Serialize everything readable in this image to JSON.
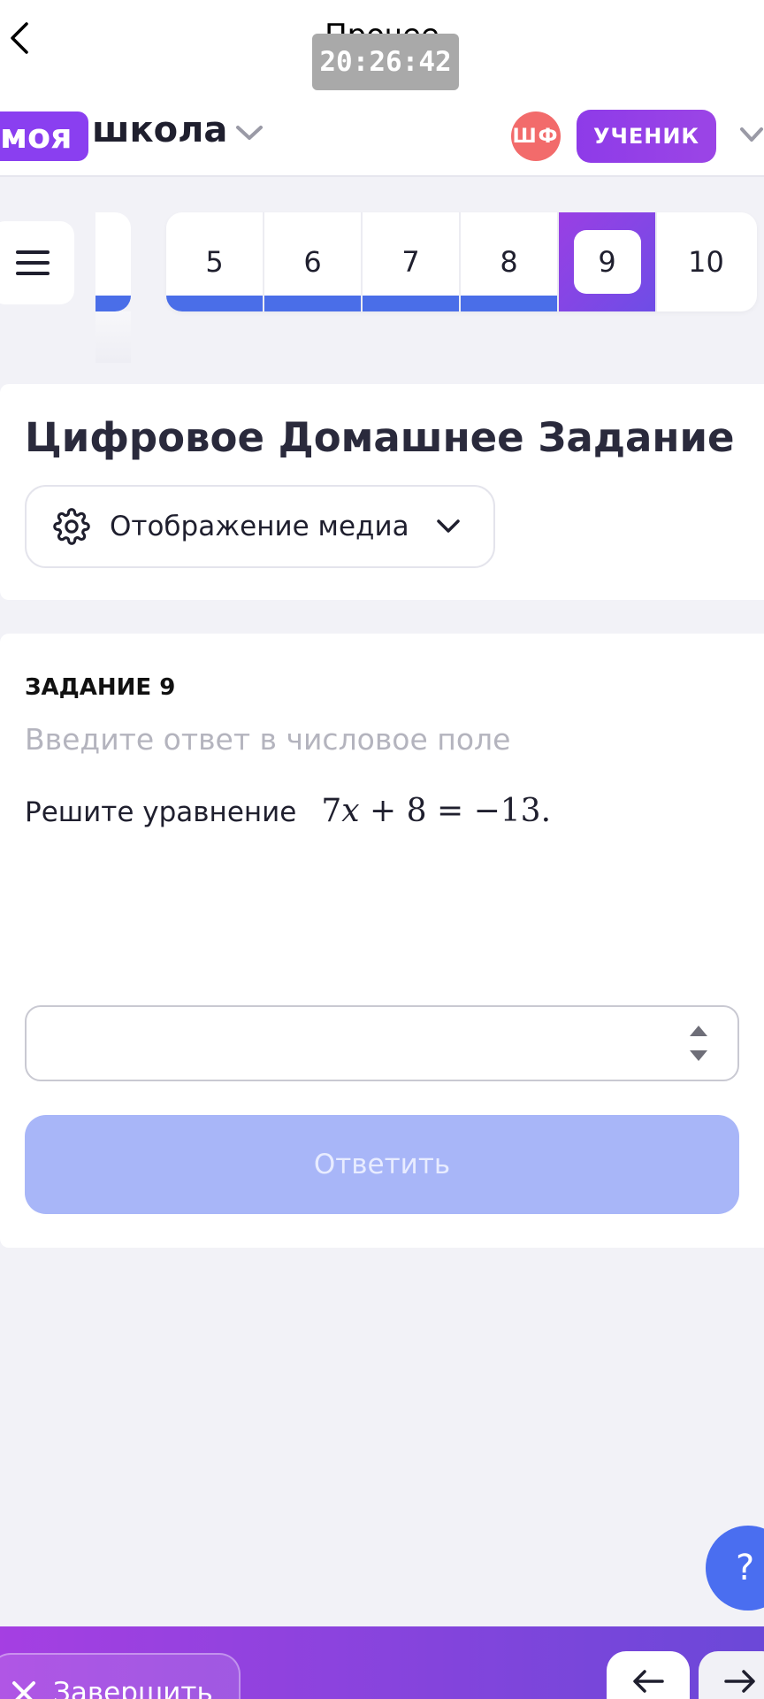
{
  "nav": {
    "back_icon": "chevron-left-icon",
    "title": "Прочее",
    "clock": "20:26:42"
  },
  "header": {
    "logo_part1": "моя",
    "logo_part2": "школа",
    "avatar_initials": "ШФ",
    "role": "УЧЕНИК"
  },
  "task_strip": {
    "items": [
      {
        "label": "5",
        "done": true
      },
      {
        "label": "6",
        "done": true
      },
      {
        "label": "7",
        "done": true
      },
      {
        "label": "8",
        "done": true
      },
      {
        "label": "9",
        "active": true
      },
      {
        "label": "10",
        "done": false
      }
    ]
  },
  "page": {
    "title": "Цифровое Домашнее Задание",
    "media_button": "Отображение медиа"
  },
  "task": {
    "label": "ЗАДАНИЕ 9",
    "hint": "Введите ответ в числовое поле",
    "prompt": "Решите уравнение",
    "equation": {
      "coef": "7",
      "var": "x",
      "rest": " + 8 = −13."
    },
    "answer_value": "",
    "submit_label": "Ответить"
  },
  "help": {
    "label": "?"
  },
  "footer": {
    "finish_label": "Завершить"
  },
  "colors": {
    "accent_purple": "#8a3ff0",
    "progress_blue": "#4a6ee8",
    "submit_disabled": "#a8b6f8",
    "avatar_red": "#f26b6b"
  }
}
